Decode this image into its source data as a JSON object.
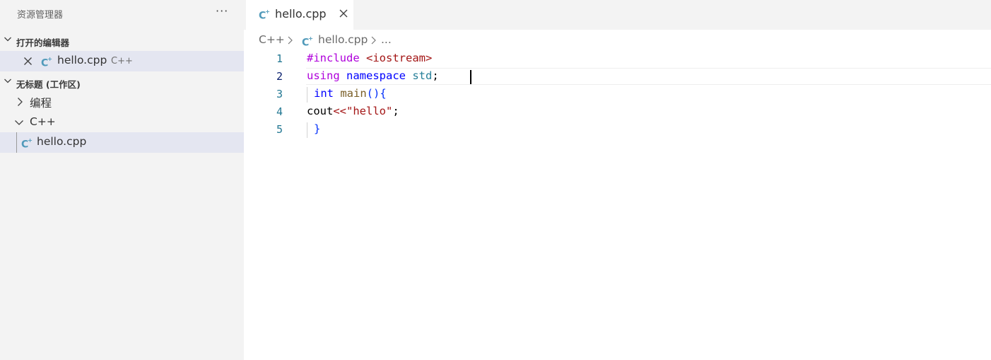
{
  "sidebar": {
    "title": "资源管理器",
    "more": "···",
    "open_editors": {
      "label": "打开的编辑器",
      "items": [
        {
          "name": "hello.cpp",
          "hint": "C++"
        }
      ]
    },
    "workspace": {
      "label": "无标题 (工作区)",
      "tree": [
        {
          "label": "编程",
          "expanded": false
        },
        {
          "label": "C++",
          "expanded": true
        },
        {
          "label": "hello.cpp",
          "selected": true
        }
      ]
    }
  },
  "tabs": [
    {
      "label": "hello.cpp",
      "active": true
    }
  ],
  "breadcrumb": [
    "C++",
    "hello.cpp",
    "..."
  ],
  "editor": {
    "line_numbers": [
      "1",
      "2",
      "3",
      "4",
      "5"
    ],
    "active_line": 2,
    "lines": [
      [
        "#include ",
        "<iostream>"
      ],
      [
        "using ",
        "namespace ",
        "std",
        ";"
      ],
      [
        "int ",
        "main",
        "(){"
      ],
      [
        "cout",
        "<<",
        "\"hello\"",
        ";"
      ],
      [
        "}"
      ]
    ]
  },
  "colors": {
    "sidebar_bg": "#f3f3f3",
    "selection_bg": "#e4e6f1",
    "cpp_icon": "#519aba",
    "line_number": "#237893"
  }
}
